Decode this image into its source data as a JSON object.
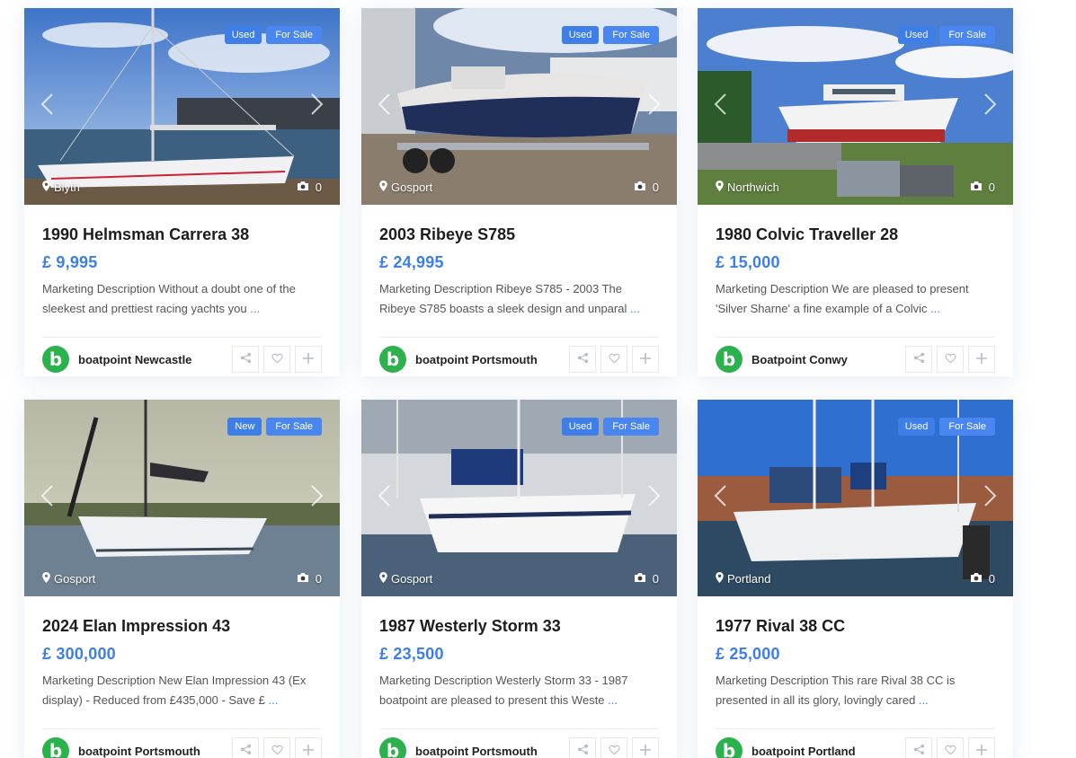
{
  "listings": [
    {
      "badges": [
        "Used",
        "For Sale"
      ],
      "location": "Blyth",
      "photo_count": "0",
      "title": "1990 Helmsman Carrera 38",
      "price": "£ 9,995",
      "description": "Marketing Description Without a doubt one of the sleekest and prettiest racing yachts you",
      "more": "...",
      "dealer": "boatpoint Newcastle",
      "scene": "harbour-sailboat"
    },
    {
      "badges": [
        "Used",
        "For Sale"
      ],
      "location": "Gosport",
      "photo_count": "0",
      "title": "2003 Ribeye S785",
      "price": "£ 24,995",
      "description": "Marketing Description Ribeye S785 - 2003 The Ribeye S785 boasts a sleek design and unparal",
      "more": "...",
      "dealer": "boatpoint Portsmouth",
      "scene": "rib-trailer"
    },
    {
      "badges": [
        "Used",
        "For Sale"
      ],
      "location": "Northwich",
      "photo_count": "0",
      "title": "1980 Colvic Traveller 28",
      "price": "£ 15,000",
      "description": "Marketing Description We are pleased to present 'Silver Sharne' a fine example of a Colvic",
      "more": "...",
      "dealer": "Boatpoint Conwy",
      "scene": "motorboat-yard"
    },
    {
      "badges": [
        "New",
        "For Sale"
      ],
      "location": "Gosport",
      "photo_count": "0",
      "title": "2024 Elan Impression 43",
      "price": "£ 300,000",
      "description": "Marketing Description New Elan Impression 43 (Ex display) - Reduced from £435,000 - Save £",
      "more": "...",
      "dealer": "boatpoint Portsmouth",
      "scene": "yacht-sea"
    },
    {
      "badges": [
        "Used",
        "For Sale"
      ],
      "location": "Gosport",
      "photo_count": "0",
      "title": "1987 Westerly Storm 33",
      "price": "£ 23,500",
      "description": "Marketing Description Westerly Storm 33 - 1987 boatpoint are pleased to present this Weste",
      "more": "...",
      "dealer": "boatpoint Portsmouth",
      "scene": "marina-yacht"
    },
    {
      "badges": [
        "Used",
        "For Sale"
      ],
      "location": "Portland",
      "photo_count": "0",
      "title": "1977 Rival 38 CC",
      "price": "£ 25,000",
      "description": "Marketing Description This rare Rival 38 CC is presented in all its glory, lovingly cared",
      "more": "...",
      "dealer": "boatpoint Portland",
      "scene": "marina-blue"
    }
  ],
  "icons": {
    "location": "map-pin-icon",
    "photos": "camera-icon",
    "share": "share-icon",
    "favorite": "heart-icon",
    "compare": "plus-icon",
    "prev": "chevron-left-icon",
    "next": "chevron-right-icon"
  },
  "avatar_letter": "b",
  "colors": {
    "accent": "#3d7ee8",
    "avatar": "#2bb24c"
  }
}
